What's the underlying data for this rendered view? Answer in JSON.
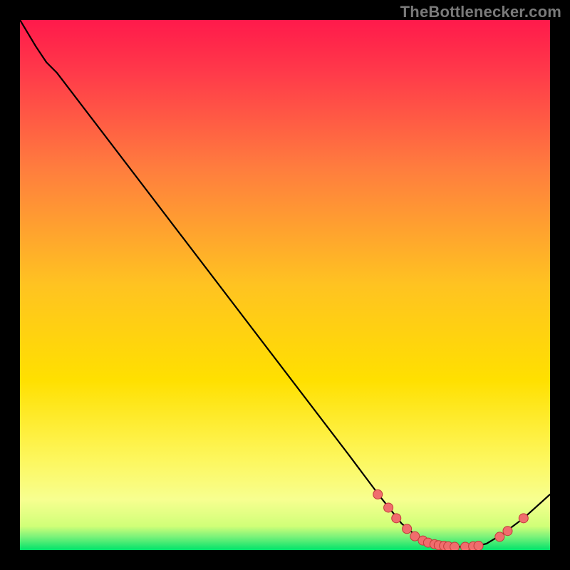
{
  "watermark": "TheBottlenecker.com",
  "palette": {
    "top": "#ff1a4b",
    "mid": "#ffe000",
    "low": "#f6ff7a",
    "bottom": "#00e36b",
    "line": "#000000",
    "marker_fill": "#f06d6d",
    "marker_stroke": "#c23a3a"
  },
  "chart_data": {
    "type": "line",
    "xlabel": "",
    "ylabel": "",
    "title": "",
    "xlim": [
      0,
      100
    ],
    "ylim": [
      0,
      100
    ],
    "curve": [
      {
        "x": 0,
        "y": 100
      },
      {
        "x": 3,
        "y": 95
      },
      {
        "x": 5,
        "y": 92
      },
      {
        "x": 7,
        "y": 90
      },
      {
        "x": 62,
        "y": 18
      },
      {
        "x": 68,
        "y": 10
      },
      {
        "x": 72,
        "y": 5
      },
      {
        "x": 75,
        "y": 2.5
      },
      {
        "x": 78,
        "y": 1.3
      },
      {
        "x": 80,
        "y": 0.8
      },
      {
        "x": 85,
        "y": 0.5
      },
      {
        "x": 88,
        "y": 1.2
      },
      {
        "x": 91,
        "y": 3
      },
      {
        "x": 95,
        "y": 6
      },
      {
        "x": 100,
        "y": 10.5
      }
    ],
    "markers": [
      {
        "x": 67.5,
        "y": 10.5
      },
      {
        "x": 69.5,
        "y": 8.0
      },
      {
        "x": 71.0,
        "y": 6.0
      },
      {
        "x": 73.0,
        "y": 4.0
      },
      {
        "x": 74.5,
        "y": 2.6
      },
      {
        "x": 76.0,
        "y": 1.8
      },
      {
        "x": 77.0,
        "y": 1.4
      },
      {
        "x": 78.2,
        "y": 1.1
      },
      {
        "x": 79.0,
        "y": 0.9
      },
      {
        "x": 80.0,
        "y": 0.8
      },
      {
        "x": 80.8,
        "y": 0.7
      },
      {
        "x": 82.0,
        "y": 0.6
      },
      {
        "x": 84.0,
        "y": 0.6
      },
      {
        "x": 85.5,
        "y": 0.7
      },
      {
        "x": 86.5,
        "y": 0.8
      },
      {
        "x": 90.5,
        "y": 2.5
      },
      {
        "x": 92.0,
        "y": 3.6
      },
      {
        "x": 95.0,
        "y": 6.0
      }
    ]
  }
}
